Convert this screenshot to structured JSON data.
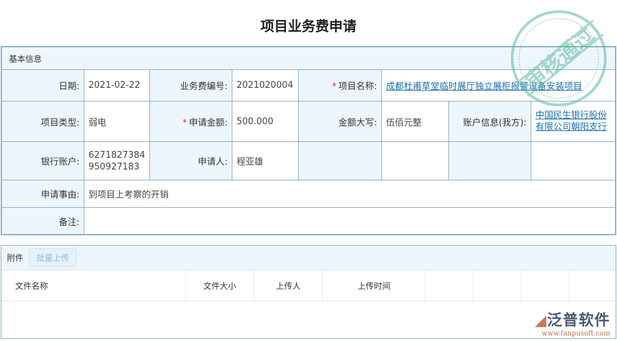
{
  "title": "项目业务费申请",
  "basic": {
    "section": "基本信息",
    "date_label": "日期:",
    "date": "2021-02-22",
    "code_label": "业务费编号:",
    "code": "2021020004",
    "project_label": "项目名称:",
    "project": "成都杜甫草堂临时展厅独立展柜报警设备安装项目",
    "type_label": "项目类型:",
    "type": "弱电",
    "amount_label": "申请金额:",
    "amount": "500.000",
    "amount_cn_label": "金额大写:",
    "amount_cn": "伍佰元整",
    "account_info_label": "账户信息(我方):",
    "account_info": "中国民生银行股份有限公司朝阳支行",
    "bank_label": "银行账户:",
    "bank": "6271827384950927183",
    "applicant_label": "申请人:",
    "applicant": "程亚雄",
    "reason_label": "申请事由:",
    "reason": "到项目上考察的开销",
    "note_label": "备注:",
    "note": ""
  },
  "attachments": {
    "section": "附件",
    "upload_button": "批量上传",
    "columns": [
      "文件名称",
      "文件大小",
      "上传人",
      "上传时间",
      "",
      "",
      "",
      ""
    ]
  },
  "stamp": "审核通过",
  "logo": {
    "name": "泛普软件",
    "url": "www.fanpusoft.com"
  },
  "colors": {
    "border": "#8fb1c4",
    "label_bg": "#eef6fd",
    "link": "#1a6fb0",
    "stamp": "#5fb9a0"
  }
}
